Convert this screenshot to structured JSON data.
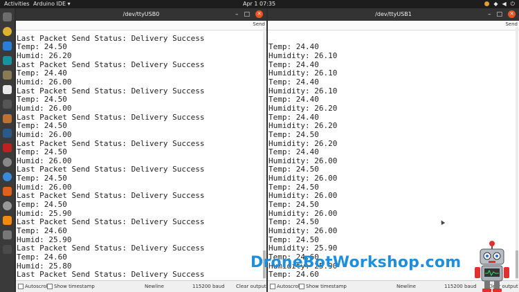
{
  "topbar": {
    "activities": "Activities",
    "app_menu": "Arduino IDE ▾",
    "clock": "Apr 1  07:35"
  },
  "window_left": {
    "title": "/dev/ttyUSB0",
    "send_label": "Send",
    "lines": [
      "Last Packet Send Status: Delivery Success",
      "Temp: 24.50",
      "Humid: 26.20",
      "Last Packet Send Status: Delivery Success",
      "Temp: 24.40",
      "Humid: 26.00",
      "Last Packet Send Status: Delivery Success",
      "Temp: 24.50",
      "Humid: 26.00",
      "Last Packet Send Status: Delivery Success",
      "Temp: 24.50",
      "Humid: 26.00",
      "Last Packet Send Status: Delivery Success",
      "Temp: 24.50",
      "Humid: 26.00",
      "Last Packet Send Status: Delivery Success",
      "Temp: 24.50",
      "Humid: 26.00",
      "Last Packet Send Status: Delivery Success",
      "Temp: 24.50",
      "Humid: 25.90",
      "Last Packet Send Status: Delivery Success",
      "Temp: 24.60",
      "Humid: 25.90",
      "Last Packet Send Status: Delivery Success",
      "Temp: 24.60",
      "Humid: 25.80",
      "Last Packet Send Status: Delivery Success"
    ],
    "autoscroll": "Autoscroll",
    "show_timestamp": "Show timestamp",
    "line_ending": "Newline",
    "baud": "115200 baud",
    "clear_output": "Clear output"
  },
  "window_right": {
    "title": "/dev/ttyUSB1",
    "send_label": "Send",
    "lines": [
      "Temp: 24.40",
      "Humidity: 26.10",
      "Temp: 24.40",
      "Humidity: 26.10",
      "Temp: 24.40",
      "Humidity: 26.10",
      "Temp: 24.40",
      "Humidity: 26.20",
      "Temp: 24.40",
      "Humidity: 26.20",
      "Temp: 24.50",
      "Humidity: 26.20",
      "Temp: 24.40",
      "Humidity: 26.00",
      "Temp: 24.50",
      "Humidity: 26.00",
      "Temp: 24.50",
      "Humidity: 26.00",
      "Temp: 24.50",
      "Humidity: 26.00",
      "Temp: 24.50",
      "Humidity: 26.00",
      "Temp: 24.50",
      "Humidity: 25.90",
      "Temp: 24.60",
      "Humidity: 25.90",
      "Temp: 24.60"
    ],
    "autoscroll": "Autoscroll",
    "show_timestamp": "Show timestamp",
    "line_ending": "Newline",
    "baud": "115200 baud",
    "clear_output": "Clear output"
  },
  "watermark": "DroneBotWorkshop.com",
  "dock_icons": [
    "files-icon",
    "chrome-icon",
    "vscode-icon",
    "arduino-icon",
    "gimp-icon",
    "text-editor-icon",
    "typora-icon",
    "sketch-icon",
    "terminal-icon",
    "filezilla-icon",
    "disk-icon",
    "help-icon",
    "app-icon",
    "settings-icon",
    "vlc-icon",
    "tools-icon",
    "apps-grid-icon"
  ]
}
